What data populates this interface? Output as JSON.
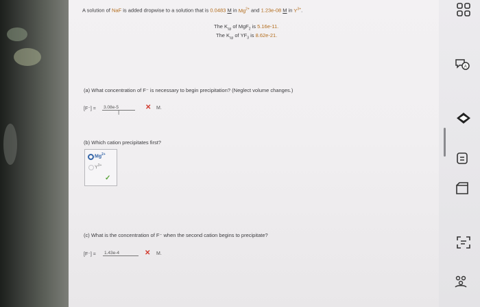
{
  "problem": {
    "intro_prefix": "A solution of",
    "salt": "NaF",
    "intro_mid": "is added dropwise to a solution that is",
    "conc1": "0.0483",
    "unit_M": "M",
    "in_word": "in",
    "ion1": "Mg",
    "ion1_charge": "2+",
    "and_word": "and",
    "conc2": "1.23e-08",
    "ion2": "Y",
    "ion2_charge": "3+",
    "ksp_line1_prefix": "The K",
    "ksp_sub": "sp",
    "ksp_line1_mid": "of MgF",
    "ksp_line1_sub": "2",
    "ksp_line1_suffix": "is",
    "ksp_value1": "5.16e-11.",
    "ksp_line2_mid": "of YF",
    "ksp_line2_sub": "3",
    "ksp_line2_suffix": "is",
    "ksp_value2": "8.62e-21."
  },
  "part_a": {
    "question": "(a) What concentration of F⁻ is necessary to begin precipitation? (Neglect volume changes.)",
    "label": "[F⁻] =",
    "value": "3.08e-5",
    "result_mark": "✕",
    "unit": "M."
  },
  "part_b": {
    "question": "(b) Which cation precipitates first?",
    "options": [
      {
        "label": "Mg",
        "charge": "2+",
        "selected": true
      },
      {
        "label": "Y",
        "charge": "3+",
        "selected": false
      }
    ],
    "result_mark": "✓"
  },
  "part_c": {
    "question": "(c) What is the concentration of F⁻ when the second cation begins to precipitate?",
    "label": "[F⁻] =",
    "value": "1.43e-4",
    "result_mark": "✕",
    "unit": "M."
  },
  "toolbar": {
    "icons": [
      "grid-icon",
      "chat-icon",
      "eye-icon",
      "rotate-icon",
      "page-icon",
      "text-recognition-icon",
      "share-icon"
    ]
  },
  "colors": {
    "highlight": "#b26b1a",
    "error": "#d23b2f",
    "correct": "#5aa43a",
    "radio_selected": "#3566a8"
  }
}
